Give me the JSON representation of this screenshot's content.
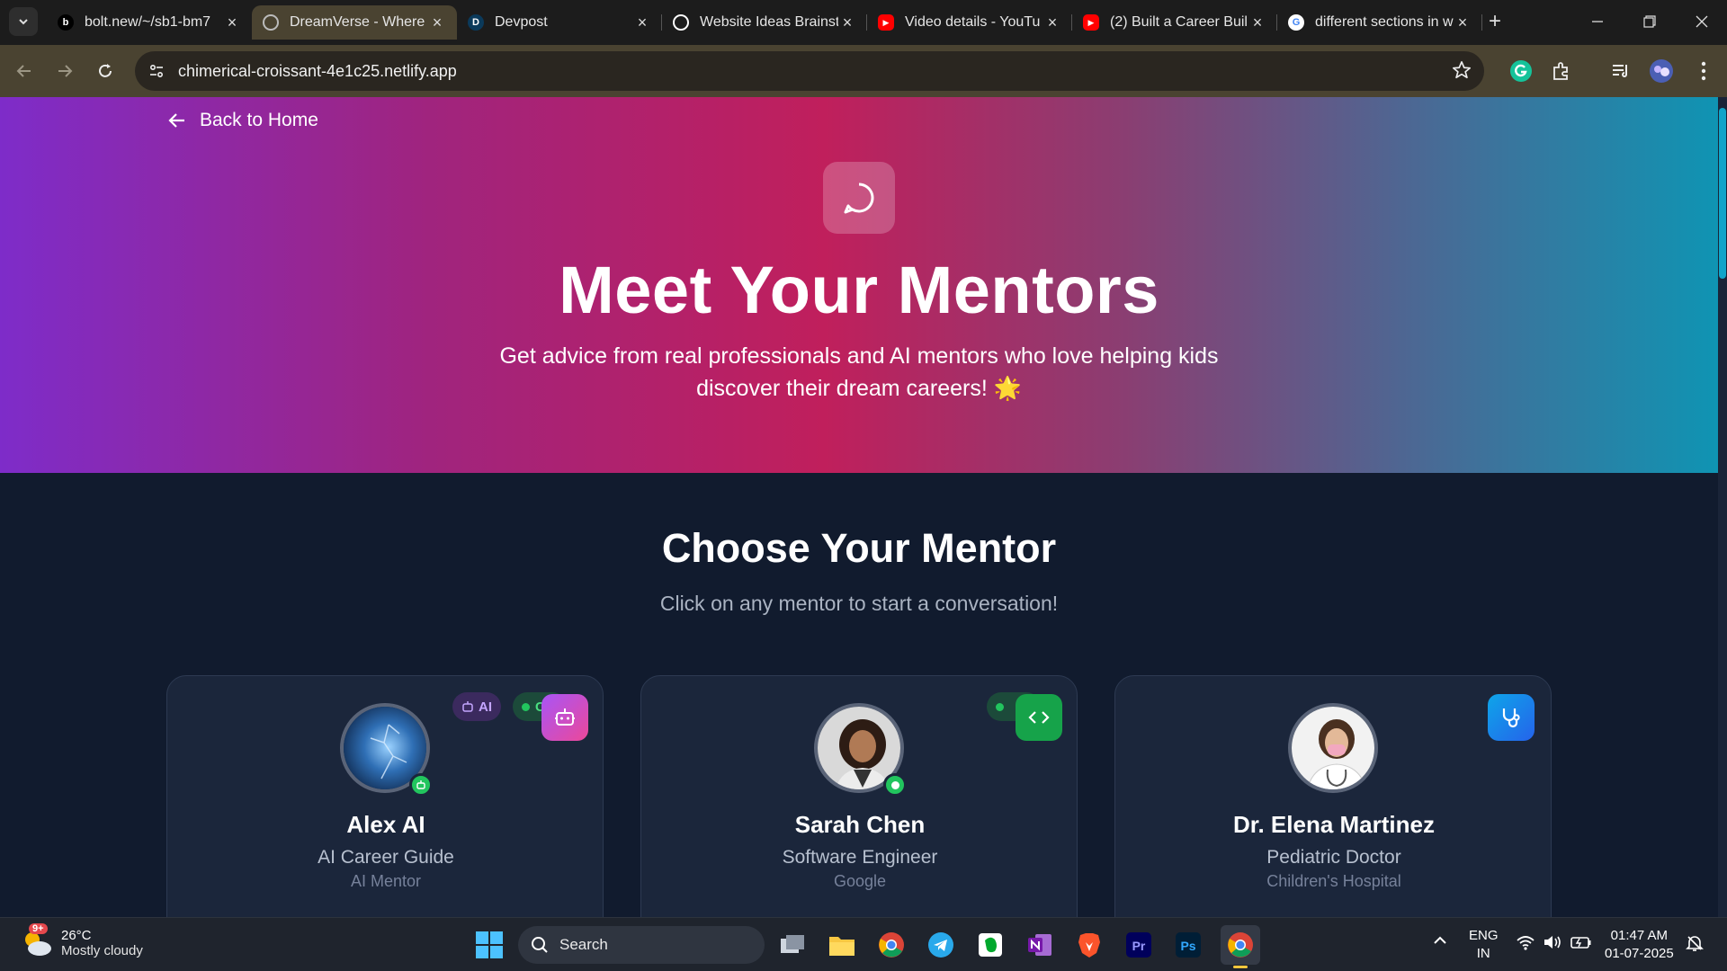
{
  "browser": {
    "tabs": [
      {
        "title": "bolt.new/~/sb1-bm7",
        "favicon": "bolt-icon",
        "favicon_text": "b",
        "color": "#000000",
        "active": false
      },
      {
        "title": "DreamVerse - Where",
        "favicon": "globe-icon",
        "favicon_text": "",
        "color": "#6b6b6b",
        "active": true
      },
      {
        "title": "Devpost",
        "favicon": "devpost-icon",
        "favicon_text": "D",
        "color": "#0b3a5b",
        "active": false
      },
      {
        "title": "Website Ideas Brainst",
        "favicon": "openai-icon",
        "favicon_text": "",
        "color": "#ffffff",
        "active": false
      },
      {
        "title": "Video details - YouTu",
        "favicon": "youtube-icon",
        "favicon_text": "",
        "color": "#ff0000",
        "active": false
      },
      {
        "title": "(2) Built a Career Buil",
        "favicon": "youtube-icon",
        "favicon_text": "",
        "color": "#ff0000",
        "active": false
      },
      {
        "title": "different sections in w",
        "favicon": "google-icon",
        "favicon_text": "",
        "color": "#ffffff",
        "active": false
      }
    ],
    "url": "chimerical-croissant-4e1c25.netlify.app"
  },
  "page": {
    "back_label": "Back to Home",
    "hero_title": "Meet Your Mentors",
    "hero_subtitle": "Get advice from real professionals and AI mentors who love helping kids discover their dream careers! 🌟",
    "section_title": "Choose Your Mentor",
    "section_subtitle": "Click on any mentor to start a conversation!",
    "mentors": [
      {
        "name": "Alex AI",
        "role": "AI Career Guide",
        "org": "AI Mentor",
        "tag": "AI",
        "corner_icon": "robot-icon",
        "accent": "#d946ef"
      },
      {
        "name": "Sarah Chen",
        "role": "Software Engineer",
        "org": "Google",
        "corner_icon": "code-icon",
        "accent": "#16a34a"
      },
      {
        "name": "Dr. Elena Martinez",
        "role": "Pediatric Doctor",
        "org": "Children's Hospital",
        "corner_icon": "stethoscope-icon",
        "accent": "#0ea5e9"
      }
    ],
    "pill_partial": "C"
  },
  "taskbar": {
    "temperature": "26°C",
    "condition": "Mostly cloudy",
    "weather_badge": "9+",
    "search_label": "Search",
    "language": "ENG",
    "region": "IN",
    "time": "01:47 AM",
    "date": "01-07-2025"
  }
}
